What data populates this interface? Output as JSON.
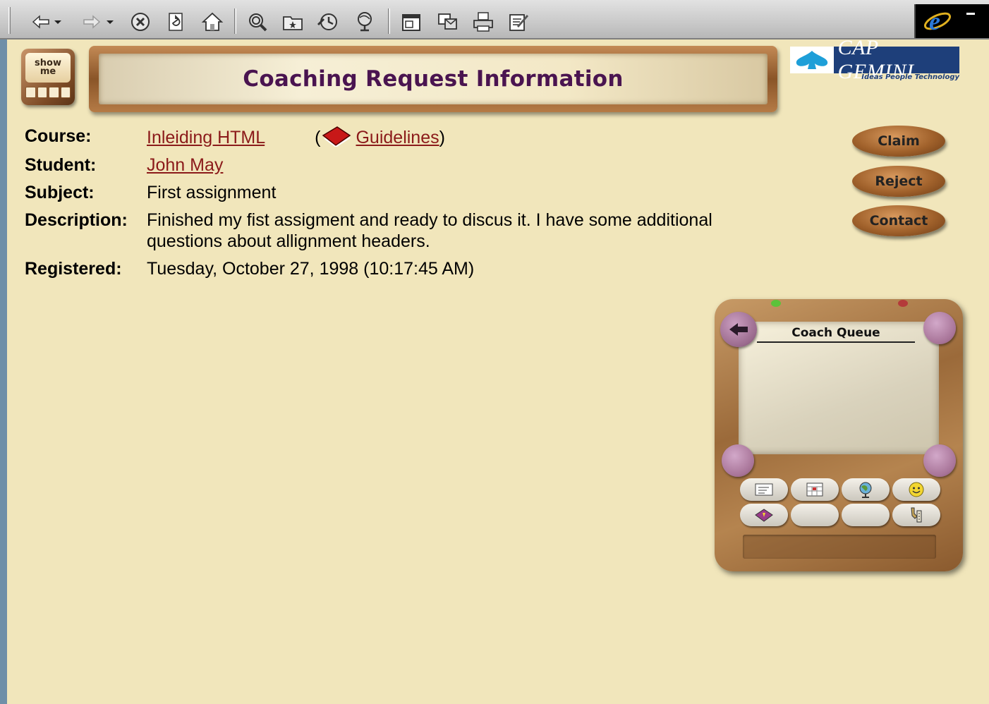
{
  "browser": {
    "toolbar_icons": [
      "back-arrow-icon",
      "forward-arrow-icon",
      "stop-icon",
      "refresh-icon",
      "home-icon",
      "search-icon",
      "favorites-icon",
      "history-icon",
      "channels-icon",
      "fullscreen-icon",
      "mail-icon",
      "print-icon",
      "edit-icon",
      "ie-logo-icon"
    ]
  },
  "header": {
    "show_me": "show me",
    "title": "Coaching Request Information",
    "logo_name": "CAP GEMINI",
    "logo_tagline": "Ideas People Technology"
  },
  "request": {
    "course_label": "Course:",
    "course_value": "Inleiding HTML",
    "guidelines_link": "Guidelines",
    "student_label": "Student:",
    "student_value": "John May",
    "subject_label": "Subject:",
    "subject_value": "First assignment",
    "description_label": "Description:",
    "description_value": "Finished my fist assigment and ready to discus it. I have some additional questions about allignment headers.",
    "registered_label": "Registered:",
    "registered_value": "Tuesday, October 27, 1998 (10:17:45 AM)"
  },
  "actions": {
    "claim": "Claim",
    "reject": "Reject",
    "contact": "Contact"
  },
  "queue": {
    "title": "Coach Queue",
    "buttons": [
      "note-icon",
      "calendar-icon",
      "globe-icon",
      "smiley-icon",
      "book-icon",
      "",
      "",
      "tools-icon"
    ]
  },
  "colors": {
    "page_bg": "#f1e6bb",
    "title_text": "#4a1450",
    "link": "#8b1a1a",
    "logo_blue": "#1e3f7a"
  }
}
